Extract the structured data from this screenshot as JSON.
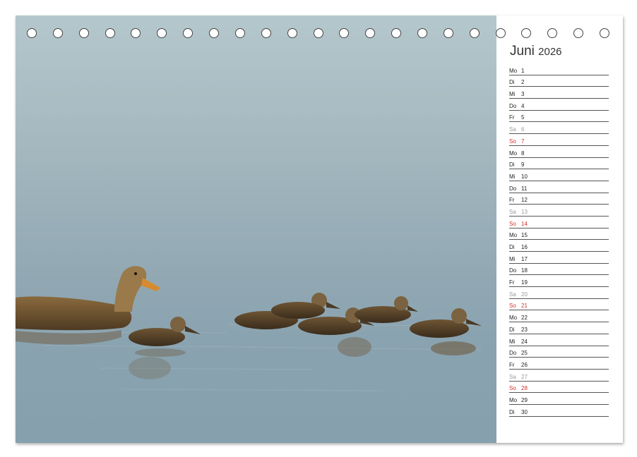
{
  "calendar": {
    "month": "Juni",
    "year": "2026",
    "days": [
      {
        "wd": "Mo",
        "d": "1",
        "type": "weekday"
      },
      {
        "wd": "Di",
        "d": "2",
        "type": "weekday"
      },
      {
        "wd": "Mi",
        "d": "3",
        "type": "weekday"
      },
      {
        "wd": "Do",
        "d": "4",
        "type": "weekday"
      },
      {
        "wd": "Fr",
        "d": "5",
        "type": "weekday"
      },
      {
        "wd": "Sa",
        "d": "6",
        "type": "sat"
      },
      {
        "wd": "So",
        "d": "7",
        "type": "sun"
      },
      {
        "wd": "Mo",
        "d": "8",
        "type": "weekday"
      },
      {
        "wd": "Di",
        "d": "9",
        "type": "weekday"
      },
      {
        "wd": "Mi",
        "d": "10",
        "type": "weekday"
      },
      {
        "wd": "Do",
        "d": "11",
        "type": "weekday"
      },
      {
        "wd": "Fr",
        "d": "12",
        "type": "weekday"
      },
      {
        "wd": "Sa",
        "d": "13",
        "type": "sat"
      },
      {
        "wd": "So",
        "d": "14",
        "type": "sun"
      },
      {
        "wd": "Mo",
        "d": "15",
        "type": "weekday"
      },
      {
        "wd": "Di",
        "d": "16",
        "type": "weekday"
      },
      {
        "wd": "Mi",
        "d": "17",
        "type": "weekday"
      },
      {
        "wd": "Do",
        "d": "18",
        "type": "weekday"
      },
      {
        "wd": "Fr",
        "d": "19",
        "type": "weekday"
      },
      {
        "wd": "Sa",
        "d": "20",
        "type": "sat"
      },
      {
        "wd": "So",
        "d": "21",
        "type": "sun"
      },
      {
        "wd": "Mo",
        "d": "22",
        "type": "weekday"
      },
      {
        "wd": "Di",
        "d": "23",
        "type": "weekday"
      },
      {
        "wd": "Mi",
        "d": "24",
        "type": "weekday"
      },
      {
        "wd": "Do",
        "d": "25",
        "type": "weekday"
      },
      {
        "wd": "Fr",
        "d": "26",
        "type": "weekday"
      },
      {
        "wd": "Sa",
        "d": "27",
        "type": "sat"
      },
      {
        "wd": "So",
        "d": "28",
        "type": "sun"
      },
      {
        "wd": "Mo",
        "d": "29",
        "type": "weekday"
      },
      {
        "wd": "Di",
        "d": "30",
        "type": "weekday"
      }
    ]
  },
  "colors": {
    "sunday": "#d0302a",
    "saturday": "#9a9a9a",
    "water": "#8aa3b0"
  },
  "binding_ring_count": 23
}
